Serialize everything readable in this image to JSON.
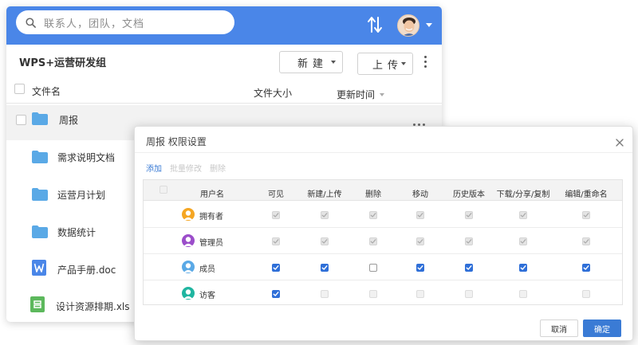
{
  "app": {
    "search_placeholder": "联系人，团队，文档",
    "group_title": "WPS+运营研发组",
    "new_button": "新建",
    "upload_button": "上传",
    "accent_color": "#4a86e8"
  },
  "file_list": {
    "columns": {
      "name": "文件名",
      "size": "文件大小",
      "updated": "更新时间"
    },
    "items": [
      {
        "name": "周报",
        "type": "folder",
        "icon": "folder-icon"
      },
      {
        "name": "需求说明文档",
        "type": "folder",
        "icon": "folder-icon"
      },
      {
        "name": "运营月计划",
        "type": "folder",
        "icon": "folder-icon"
      },
      {
        "name": "数据统计",
        "type": "folder",
        "icon": "folder-icon"
      },
      {
        "name": "产品手册.doc",
        "type": "doc",
        "icon": "word-doc-icon"
      },
      {
        "name": "设计资源排期.xls",
        "type": "xls",
        "icon": "sheet-xls-icon"
      }
    ]
  },
  "dialog": {
    "title": "周报 权限设置",
    "actions": {
      "add": "添加",
      "batch_edit": "批量修改",
      "delete": "删除"
    },
    "columns": [
      "用户名",
      "可见",
      "新建/上传",
      "删除",
      "移动",
      "历史版本",
      "下载/分享/复制",
      "编辑/重命名"
    ],
    "rows": [
      {
        "user": "拥有者",
        "avatar_color": "#f5a623",
        "perms": [
          true,
          true,
          true,
          true,
          true,
          true,
          true
        ],
        "editable": false
      },
      {
        "user": "管理员",
        "avatar_color": "#9b4dca",
        "perms": [
          true,
          true,
          true,
          true,
          true,
          true,
          true
        ],
        "editable": false
      },
      {
        "user": "成员",
        "avatar_color": "#5aa9e6",
        "perms": [
          true,
          true,
          false,
          true,
          true,
          true,
          true
        ],
        "editable": true
      },
      {
        "user": "访客",
        "avatar_color": "#1fb5a0",
        "perms": [
          true,
          false,
          false,
          false,
          false,
          false,
          false
        ],
        "editable": "first-only"
      }
    ],
    "cancel": "取消",
    "confirm": "确定"
  }
}
